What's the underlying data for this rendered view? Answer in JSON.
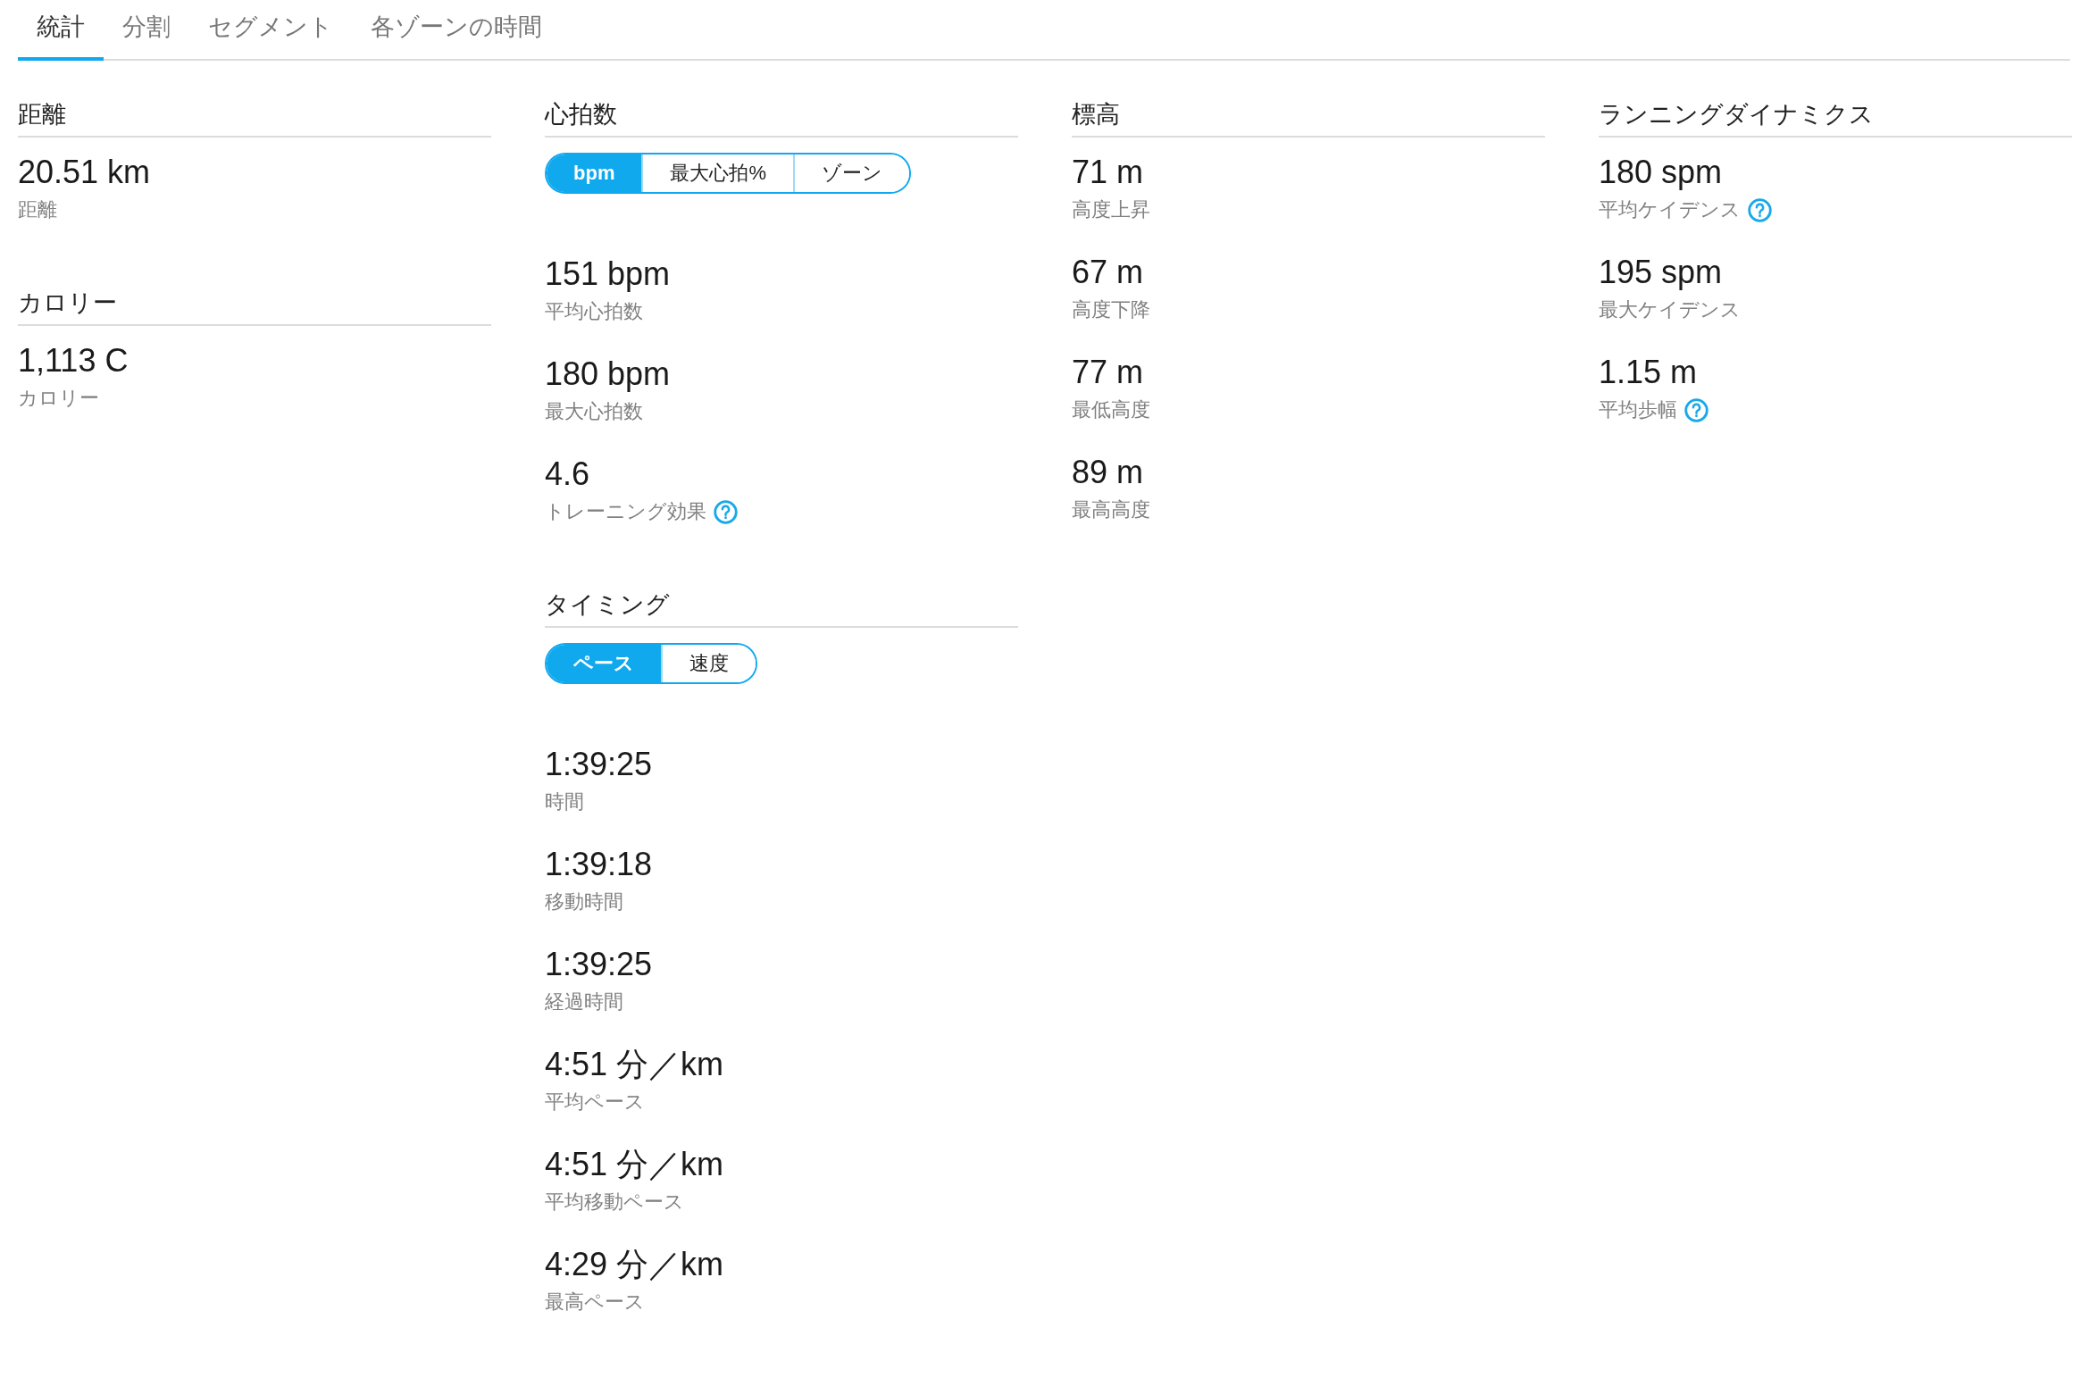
{
  "tabs": [
    {
      "label": "統計",
      "selected": true
    },
    {
      "label": "分割",
      "selected": false
    },
    {
      "label": "セグメント",
      "selected": false
    },
    {
      "label": "各ゾーンの時間",
      "selected": false
    }
  ],
  "columns": [
    {
      "sections": [
        {
          "title": "距離",
          "stats": [
            {
              "value": "20.51 km",
              "label": "距離"
            }
          ]
        },
        {
          "title": "カロリー",
          "stats": [
            {
              "value": "1,113 C",
              "label": "カロリー"
            }
          ]
        }
      ]
    },
    {
      "sections": [
        {
          "title": "心拍数",
          "toggle": [
            {
              "label": "bpm",
              "selected": true
            },
            {
              "label": "最大心拍%",
              "selected": false
            },
            {
              "label": "ゾーン",
              "selected": false
            }
          ],
          "stats": [
            {
              "value": "151 bpm",
              "label": "平均心拍数"
            },
            {
              "value": "180 bpm",
              "label": "最大心拍数"
            },
            {
              "value": "4.6",
              "label": "トレーニング効果",
              "help": true
            }
          ]
        },
        {
          "title": "タイミング",
          "toggle": [
            {
              "label": "ペース",
              "selected": true
            },
            {
              "label": "速度",
              "selected": false
            }
          ],
          "stats": [
            {
              "value": "1:39:25",
              "label": "時間"
            },
            {
              "value": "1:39:18",
              "label": "移動時間"
            },
            {
              "value": "1:39:25",
              "label": "経過時間"
            },
            {
              "value": "4:51 分／km",
              "label": "平均ペース"
            },
            {
              "value": "4:51 分／km",
              "label": "平均移動ペース"
            },
            {
              "value": "4:29 分／km",
              "label": "最高ペース"
            }
          ]
        }
      ]
    },
    {
      "sections": [
        {
          "title": "標高",
          "stats": [
            {
              "value": "71 m",
              "label": "高度上昇"
            },
            {
              "value": "67 m",
              "label": "高度下降"
            },
            {
              "value": "77 m",
              "label": "最低高度"
            },
            {
              "value": "89 m",
              "label": "最高高度"
            }
          ]
        }
      ]
    },
    {
      "sections": [
        {
          "title": "ランニングダイナミクス",
          "stats": [
            {
              "value": "180 spm",
              "label": "平均ケイデンス",
              "help": true
            },
            {
              "value": "195 spm",
              "label": "最大ケイデンス"
            },
            {
              "value": "1.15 m",
              "label": "平均歩幅",
              "help": true
            }
          ]
        }
      ]
    }
  ]
}
